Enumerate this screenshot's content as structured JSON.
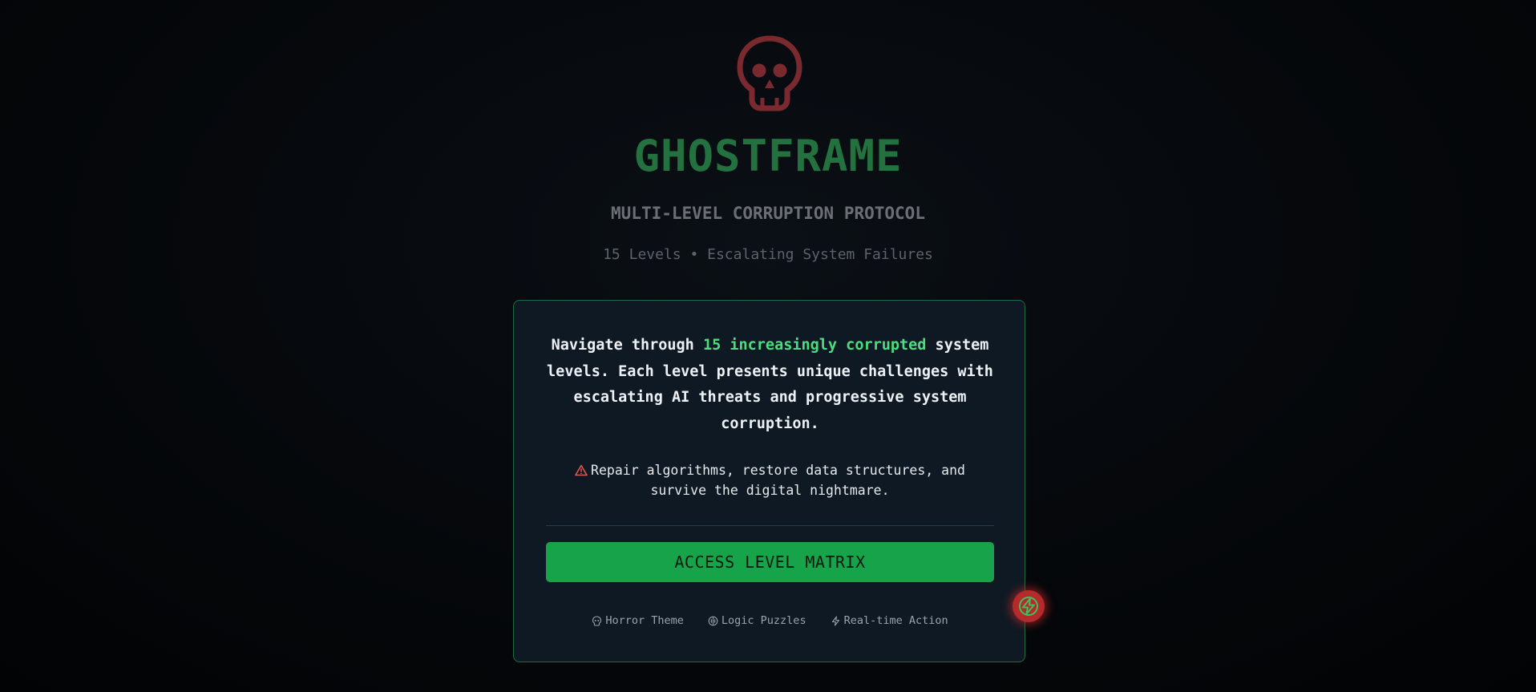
{
  "header": {
    "logo_icon": "skull-icon",
    "title": "GHOSTFRAME",
    "subtitle": "MULTI-LEVEL CORRUPTION PROTOCOL",
    "tagline": "15 Levels • Escalating System Failures"
  },
  "intro_card": {
    "description_prefix": "Navigate through ",
    "description_highlight": "15 increasingly corrupted",
    "description_suffix": " system levels. Each level presents unique challenges with escalating AI threats and progressive system corruption.",
    "warning_icon": "warning-triangle-icon",
    "warning_text": "Repair algorithms, restore data structures, and survive the digital nightmare.",
    "cta_label": "ACCESS LEVEL MATRIX",
    "features": [
      {
        "icon": "skull-icon",
        "label": "Horror Theme"
      },
      {
        "icon": "brain-icon",
        "label": "Logic Puzzles"
      },
      {
        "icon": "lightning-icon",
        "label": "Real-time Action"
      }
    ]
  },
  "floating_button": {
    "icon": "lightning-icon"
  },
  "colors": {
    "accent_green": "#4ade80",
    "title_green": "#23713f",
    "button_green": "#16a34a",
    "danger_red": "#b52a2a",
    "card_bg": "#0f1923",
    "card_border": "#1f6a43"
  }
}
